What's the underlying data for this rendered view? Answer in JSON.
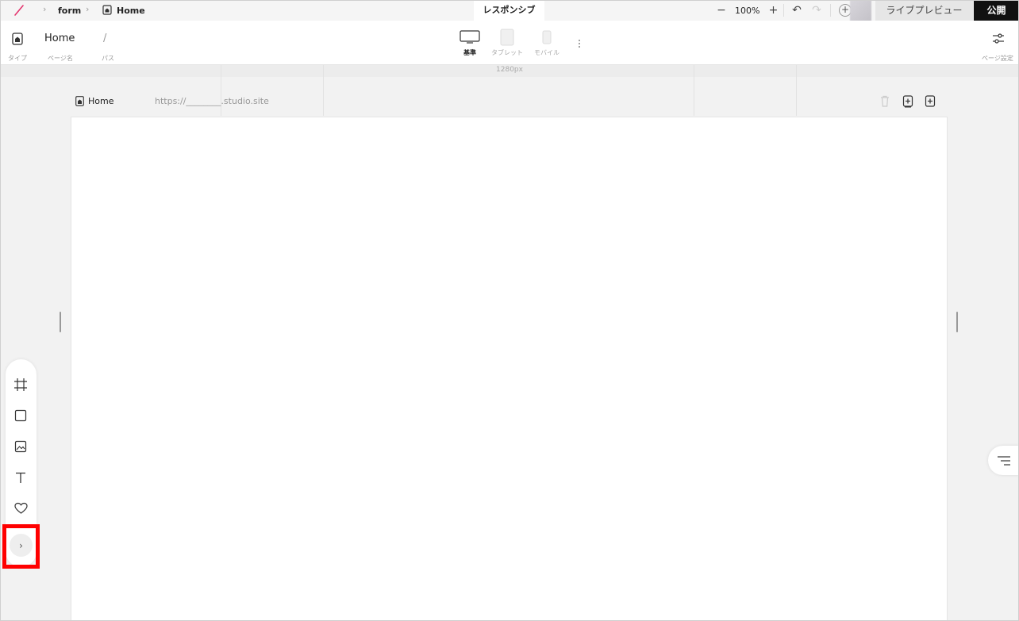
{
  "topbar": {
    "breadcrumb_project": "form",
    "breadcrumb_page": "Home",
    "responsive_tab": "レスポンシブ",
    "zoom_minus": "−",
    "zoom_value": "100%",
    "zoom_plus": "+",
    "undo": "↶",
    "redo": "↷",
    "add": "+",
    "live_preview": "ライブプレビュー",
    "publish": "公開"
  },
  "header": {
    "type_label": "タイプ",
    "page_name": "Home",
    "page_name_label": "ページ名",
    "path_value": "/",
    "path_label": "パス",
    "devices": [
      {
        "label": "基準",
        "active": true
      },
      {
        "label": "タブレット",
        "active": false
      },
      {
        "label": "モバイル",
        "active": false
      }
    ],
    "page_settings_label": "ページ設定"
  },
  "ruler": {
    "width_label": "1280px"
  },
  "canvas": {
    "page_label": "Home",
    "url": "https://________.studio.site"
  },
  "left_toolbar": {
    "expand": "›"
  },
  "colors": {
    "accent_logo": "#e4356e",
    "publish_bg": "#111111",
    "highlight": "#ff0000"
  }
}
